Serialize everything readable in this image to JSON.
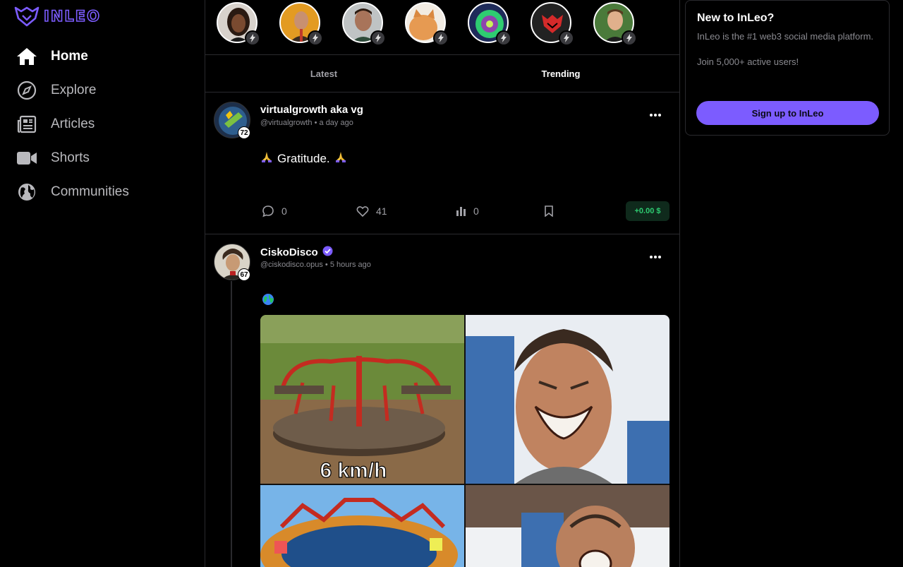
{
  "brand": {
    "name": "INLEO",
    "color": "#7c5cff"
  },
  "nav": [
    {
      "label": "Home",
      "icon": "home-icon",
      "active": true
    },
    {
      "label": "Explore",
      "icon": "compass-icon"
    },
    {
      "label": "Articles",
      "icon": "newspaper-icon"
    },
    {
      "label": "Shorts",
      "icon": "video-camera-icon"
    },
    {
      "label": "Communities",
      "icon": "globe-icon"
    }
  ],
  "feed": {
    "tabs": [
      "Latest",
      "Trending"
    ],
    "active_tab": "Trending",
    "posts": [
      {
        "author": "virtualgrowth aka vg",
        "handle": "@virtualgrowth",
        "time": "a day ago",
        "reputation": "72",
        "text": "Gratitude.",
        "replies": "0",
        "likes": "41",
        "views": "0",
        "payout": "+0.00 $"
      },
      {
        "author": "CiskoDisco",
        "verified": true,
        "handle": "@ciskodisco.opus",
        "time": "5 hours ago",
        "reputation": "67",
        "meme_labels": [
          "6 km/h"
        ]
      }
    ]
  },
  "promo": {
    "title": "New to InLeo?",
    "description": "InLeo is the #1 web3 social media platform.",
    "join": "Join 5,000+ active users!",
    "button": "Sign up to InLeo"
  },
  "colors": {
    "payout": "#2ecc71",
    "accent": "#7c5cff",
    "verified": "#7c5cff"
  }
}
